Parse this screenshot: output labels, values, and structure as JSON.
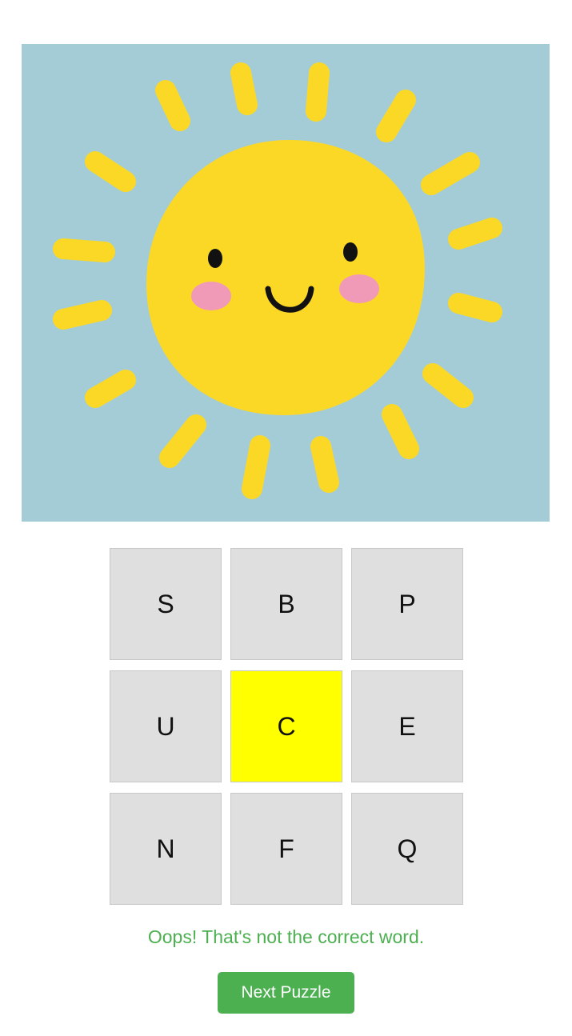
{
  "image": {
    "icon": "smiling-sun-illustration",
    "background_color": "#a3ccd6",
    "sun_color": "#fbd826",
    "cheek_color": "#f09ab8"
  },
  "grid": {
    "tiles": [
      "S",
      "B",
      "P",
      "U",
      "C",
      "E",
      "N",
      "F",
      "Q"
    ],
    "selected_index": 4,
    "tile_color": "#dfdfdf",
    "selected_color": "#ffff00"
  },
  "feedback": {
    "message": "Oops! That's not the correct word.",
    "color": "#4caf50"
  },
  "actions": {
    "next_label": "Next Puzzle"
  }
}
